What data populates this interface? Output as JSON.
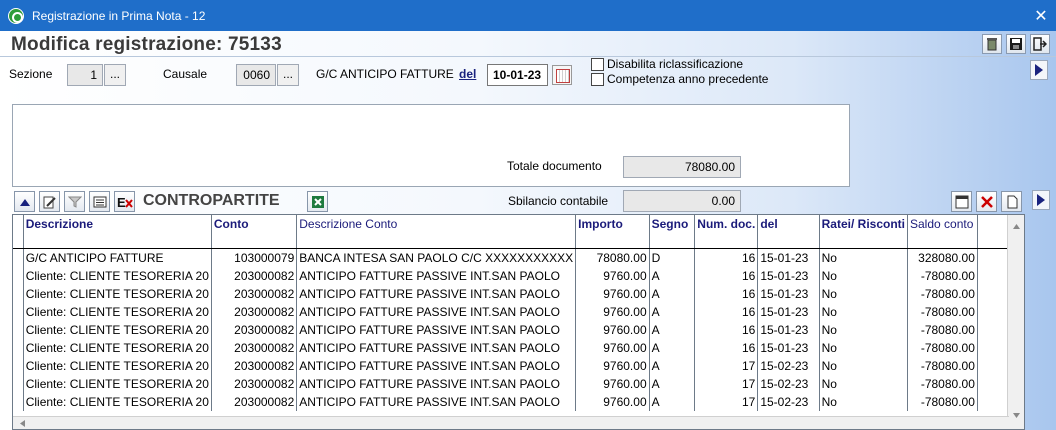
{
  "window": {
    "title": "Registrazione in Prima Nota - 12",
    "close": "✕"
  },
  "header": {
    "title": "Modifica registrazione:  75133"
  },
  "form": {
    "sezione_label": "Sezione",
    "sezione_value": "1",
    "causale_label": "Causale",
    "causale_value": "0060",
    "causale_desc": "G/C ANTICIPO FATTURE",
    "del_label": "del",
    "date_value": "10-01-23",
    "dots": "...",
    "chk1_label": "Disabilita riclassificazione",
    "chk2_label": "Competenza anno precedente",
    "totale_label": "Totale documento",
    "totale_value": "78080.00"
  },
  "contropartite": {
    "title": "CONTROPARTITE",
    "sbilancio_label": "Sbilancio contabile",
    "sbilancio_value": "0.00"
  },
  "table": {
    "headers": [
      "Descrizione",
      "Conto",
      "Descrizione Conto",
      "Importo",
      "Segno",
      "Num. doc.",
      "del",
      "Ratei/ Risconti",
      "Saldo conto"
    ],
    "rows": [
      [
        "G/C ANTICIPO FATTURE",
        "103000079",
        "BANCA INTESA SAN PAOLO C/C XXXXXXXXXXX",
        "78080.00",
        "D",
        "16",
        "15-01-23",
        "No",
        "328080.00"
      ],
      [
        "Cliente: CLIENTE TESORERIA 20",
        "203000082",
        "ANTICIPO FATTURE PASSIVE INT.SAN PAOLO",
        "9760.00",
        "A",
        "16",
        "15-01-23",
        "No",
        "-78080.00"
      ],
      [
        "Cliente: CLIENTE TESORERIA 20",
        "203000082",
        "ANTICIPO FATTURE PASSIVE INT.SAN PAOLO",
        "9760.00",
        "A",
        "16",
        "15-01-23",
        "No",
        "-78080.00"
      ],
      [
        "Cliente: CLIENTE TESORERIA 20",
        "203000082",
        "ANTICIPO FATTURE PASSIVE INT.SAN PAOLO",
        "9760.00",
        "A",
        "16",
        "15-01-23",
        "No",
        "-78080.00"
      ],
      [
        "Cliente: CLIENTE TESORERIA 20",
        "203000082",
        "ANTICIPO FATTURE PASSIVE INT.SAN PAOLO",
        "9760.00",
        "A",
        "16",
        "15-01-23",
        "No",
        "-78080.00"
      ],
      [
        "Cliente: CLIENTE TESORERIA 20",
        "203000082",
        "ANTICIPO FATTURE PASSIVE INT.SAN PAOLO",
        "9760.00",
        "A",
        "16",
        "15-01-23",
        "No",
        "-78080.00"
      ],
      [
        "Cliente: CLIENTE TESORERIA 20",
        "203000082",
        "ANTICIPO FATTURE PASSIVE INT.SAN PAOLO",
        "9760.00",
        "A",
        "17",
        "15-02-23",
        "No",
        "-78080.00"
      ],
      [
        "Cliente: CLIENTE TESORERIA 20",
        "203000082",
        "ANTICIPO FATTURE PASSIVE INT.SAN PAOLO",
        "9760.00",
        "A",
        "17",
        "15-02-23",
        "No",
        "-78080.00"
      ],
      [
        "Cliente: CLIENTE TESORERIA 20",
        "203000082",
        "ANTICIPO FATTURE PASSIVE INT.SAN PAOLO",
        "9760.00",
        "A",
        "17",
        "15-02-23",
        "No",
        "-78080.00"
      ]
    ]
  },
  "icons": {
    "app": "q-logo-icon",
    "recycle": "recycle-icon",
    "save": "save-icon",
    "exit": "exit-icon",
    "calendar": "calendar-icon",
    "excel": "excel-icon"
  }
}
